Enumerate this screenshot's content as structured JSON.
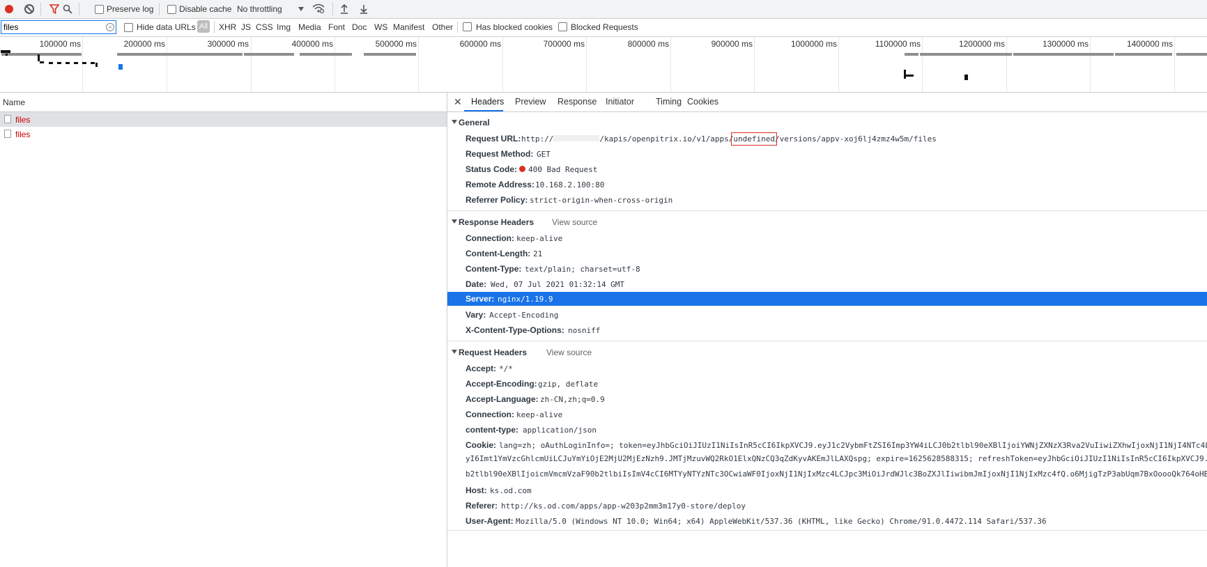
{
  "toolbar": {
    "record_icon": "record-icon",
    "clear_icon": "clear-icon",
    "filter_icon": "filter-icon",
    "search_icon": "search-icon",
    "preserve_log": "Preserve log",
    "disable_cache": "Disable cache",
    "throttling": "No throttling",
    "wifi_icon": "network-conditions-icon",
    "import_icon": "import-har-icon",
    "export_icon": "export-har-icon",
    "accent": "#d93025"
  },
  "filterbar": {
    "filter_value": "files",
    "hide_data_urls": "Hide data URLs",
    "types": [
      "All",
      "XHR",
      "JS",
      "CSS",
      "Img",
      "Media",
      "Font",
      "Doc",
      "WS",
      "Manifest",
      "Other"
    ],
    "has_blocked_cookies": "Has blocked cookies",
    "blocked_requests": "Blocked Requests"
  },
  "overview": {
    "ticks": [
      "100000 ms",
      "200000 ms",
      "300000 ms",
      "400000 ms",
      "500000 ms",
      "600000 ms",
      "700000 ms",
      "800000 ms",
      "900000 ms",
      "1000000 ms",
      "1100000 ms",
      "1200000 ms",
      "1300000 ms",
      "1400000 ms"
    ]
  },
  "requests": {
    "column_name": "Name",
    "rows": [
      {
        "name": "files",
        "status": "error"
      },
      {
        "name": "files",
        "status": "error"
      }
    ]
  },
  "details": {
    "close_icon": "close-icon",
    "tabs": [
      "Headers",
      "Preview",
      "Response",
      "Initiator",
      "Timing",
      "Cookies"
    ],
    "active_tab": "Headers",
    "general": {
      "title": "General",
      "request_url_key": "Request URL:",
      "request_url_prefix": "http://",
      "request_url_mid": "/kapis/openpitrix.io/v1/apps/",
      "request_url_highlight": "undefined",
      "request_url_suffix": "/versions/appv-xoj6lj4zmz4w5m/files",
      "request_method_key": "Request Method:",
      "request_method": "GET",
      "status_code_key": "Status Code:",
      "status_code": "400 Bad Request",
      "status_color": "#d93025",
      "remote_address_key": "Remote Address:",
      "remote_address": "10.168.2.100:80",
      "referrer_policy_key": "Referrer Policy:",
      "referrer_policy": "strict-origin-when-cross-origin"
    },
    "response_headers": {
      "title": "Response Headers",
      "view_source": "View source",
      "rows": [
        {
          "k": "Connection:",
          "v": "keep-alive"
        },
        {
          "k": "Content-Length:",
          "v": "21"
        },
        {
          "k": "Content-Type:",
          "v": "text/plain; charset=utf-8"
        },
        {
          "k": "Date:",
          "v": "Wed, 07 Jul 2021 01:32:14 GMT"
        },
        {
          "k": "Server:",
          "v": "nginx/1.19.9"
        },
        {
          "k": "Vary:",
          "v": "Accept-Encoding"
        },
        {
          "k": "X-Content-Type-Options:",
          "v": "nosniff"
        }
      ]
    },
    "request_headers": {
      "title": "Request Headers",
      "view_source": "View source",
      "accept_k": "Accept:",
      "accept_v": "*/*",
      "accept_encoding_k": "Accept-Encoding:",
      "accept_encoding_v": "gzip, deflate",
      "accept_language_k": "Accept-Language:",
      "accept_language_v": "zh-CN,zh;q=0.9",
      "connection_k": "Connection:",
      "connection_v": "keep-alive",
      "content_type_k": "content-type:",
      "content_type_v": "application/json",
      "cookie_k": "Cookie:",
      "cookie_line1": "lang=zh; oAuthLoginInfo=; token=eyJhbGciOiJIUzI1NiIsInR5cCI6IkpXVCJ9.eyJ1c2VybmFtZSI6Imp3YW4iLCJ0b2tlbl90eXBlIjoiYWNjZXNzX3Rva2VuIiwiZXhwIjoxNjI1NjI4NTc4LCJ",
      "cookie_line2": "yI6Imt1YmVzcGhlcmUiLCJuYmYiOjE2MjU2MjEzNzh9.JMTjMzuvWQ2RkO1ElxQNzCQ3qZdKyvAKEmJlLAXQspg; expire=1625628588315; refreshToken=eyJhbGciOiJIUzI1NiIsInR5cCI6IkpXVCJ9.",
      "cookie_line3": "b2tlbl90eXBlIjoicmVmcmVzaF90b2tlbiIsImV4cCI6MTYyNTYzNTc3OCwiaWF0IjoxNjI1NjIxMzc4LCJpc3MiOiJrdWJlc3BoZXJlIiwibmJmIjoxNjI1NjIxMzc4fQ.o6MjigTzP3abUqm7BxOoooQk764oHB",
      "host_k": "Host:",
      "host_v": "ks.od.com",
      "referer_k": "Referer:",
      "referer_v": "http://ks.od.com/apps/app-w203p2mm3m17y0-store/deploy",
      "user_agent_k": "User-Agent:",
      "user_agent_v": "Mozilla/5.0 (Windows NT 10.0; Win64; x64) AppleWebKit/537.36 (KHTML, like Gecko) Chrome/91.0.4472.114 Safari/537.36"
    }
  }
}
